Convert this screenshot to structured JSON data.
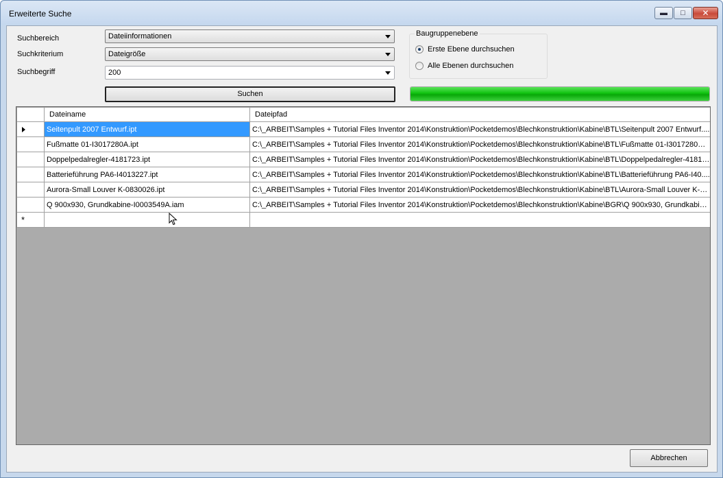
{
  "window": {
    "title": "Erweiterte Suche"
  },
  "form": {
    "suchbereich": {
      "label": "Suchbereich",
      "value": "Dateiinformationen"
    },
    "suchkriterium": {
      "label": "Suchkriterium",
      "value": "Dateigröße"
    },
    "suchbegriff": {
      "label": "Suchbegriff",
      "value": "200"
    },
    "search_button": "Suchen"
  },
  "baugruppenebene": {
    "title": "Baugruppenebene",
    "options": [
      {
        "label": "Erste Ebene durchsuchen",
        "checked": true
      },
      {
        "label": "Alle Ebenen durchsuchen",
        "checked": false
      }
    ]
  },
  "progress": {
    "percent": 100,
    "color": "#0fc20f"
  },
  "results": {
    "columns": [
      "Dateiname",
      "Dateipfad"
    ],
    "rows": [
      {
        "name": "Seitenpult 2007 Entwurf.ipt",
        "path": "C:\\_ARBEIT\\Samples + Tutorial Files Inventor 2014\\Konstruktion\\Pocketdemos\\Blechkonstruktion\\Kabine\\BTL\\Seitenpult 2007 Entwurf...."
      },
      {
        "name": "Fußmatte 01-I3017280A.ipt",
        "path": "C:\\_ARBEIT\\Samples + Tutorial Files Inventor 2014\\Konstruktion\\Pocketdemos\\Blechkonstruktion\\Kabine\\BTL\\Fußmatte 01-I3017280A...."
      },
      {
        "name": "Doppelpedalregler-4181723.ipt",
        "path": "C:\\_ARBEIT\\Samples + Tutorial Files Inventor 2014\\Konstruktion\\Pocketdemos\\Blechkonstruktion\\Kabine\\BTL\\Doppelpedalregler-4181...."
      },
      {
        "name": "Batterieführung PA6-I4013227.ipt",
        "path": "C:\\_ARBEIT\\Samples + Tutorial Files Inventor 2014\\Konstruktion\\Pocketdemos\\Blechkonstruktion\\Kabine\\BTL\\Batterieführung PA6-I40...."
      },
      {
        "name": "Aurora-Small Louver K-0830026.ipt",
        "path": "C:\\_ARBEIT\\Samples + Tutorial Files Inventor 2014\\Konstruktion\\Pocketdemos\\Blechkonstruktion\\Kabine\\BTL\\Aurora-Small Louver K-0...."
      },
      {
        "name": "Q 900x930, Grundkabine-I0003549A.iam",
        "path": "C:\\_ARBEIT\\Samples + Tutorial Files Inventor 2014\\Konstruktion\\Pocketdemos\\Blechkonstruktion\\Kabine\\BGR\\Q 900x930, Grundkabin...."
      }
    ],
    "new_row_marker": "*"
  },
  "cancel_button": "Abbrechen",
  "colors": {
    "selection": "#3399ff",
    "grid_background": "#ababab"
  },
  "icons": {
    "minimize": "minimize-icon",
    "maximize": "maximize-icon",
    "close": "close-icon"
  }
}
